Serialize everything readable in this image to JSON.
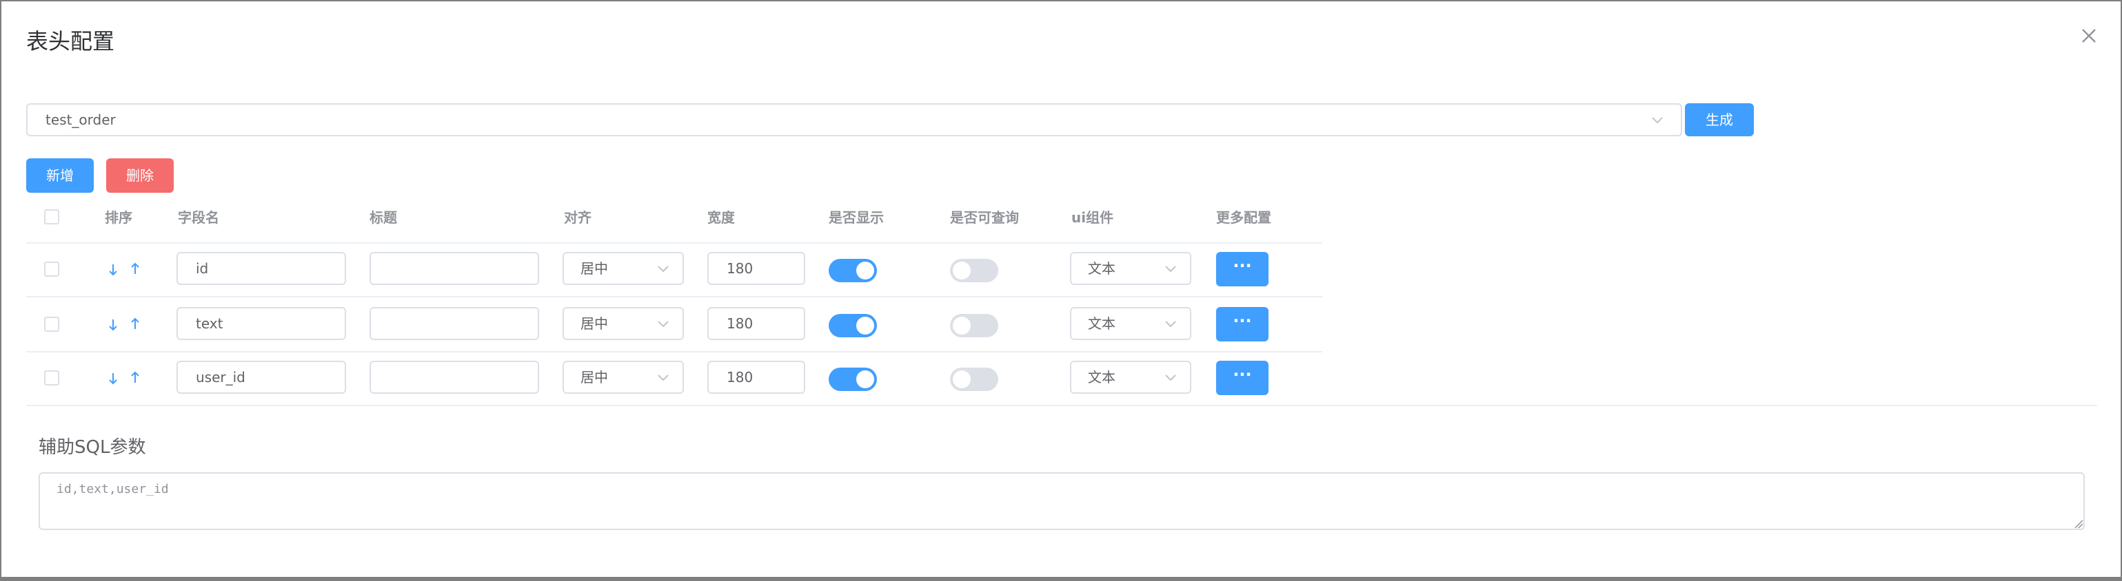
{
  "dialog": {
    "title": "表头配置"
  },
  "table_select": {
    "value": "test_order"
  },
  "toolbar": {
    "generate_label": "生成",
    "add_label": "新增",
    "delete_label": "删除"
  },
  "columns": {
    "sort": "排序",
    "field": "字段名",
    "title": "标题",
    "align": "对齐",
    "width": "宽度",
    "show": "是否显示",
    "query": "是否可查询",
    "ui": "ui组件",
    "more": "更多配置"
  },
  "rows": [
    {
      "field": "id",
      "title": "",
      "align": "居中",
      "width": "180",
      "show": true,
      "query": false,
      "ui": "文本",
      "more_label": "···"
    },
    {
      "field": "text",
      "title": "",
      "align": "居中",
      "width": "180",
      "show": true,
      "query": false,
      "ui": "文本",
      "more_label": "···"
    },
    {
      "field": "user_id",
      "title": "",
      "align": "居中",
      "width": "180",
      "show": true,
      "query": false,
      "ui": "文本",
      "more_label": "···"
    }
  ],
  "sql_section": {
    "title": "辅助SQL参数",
    "value": "id,text,user_id"
  },
  "colors": {
    "primary": "#409eff",
    "danger": "#f56c6c",
    "switch_off": "#dcdfe6"
  },
  "icons": {
    "close": "close-icon",
    "chevron": "chevron-down-icon",
    "down": "arrow-down-icon",
    "up": "arrow-up-icon"
  }
}
